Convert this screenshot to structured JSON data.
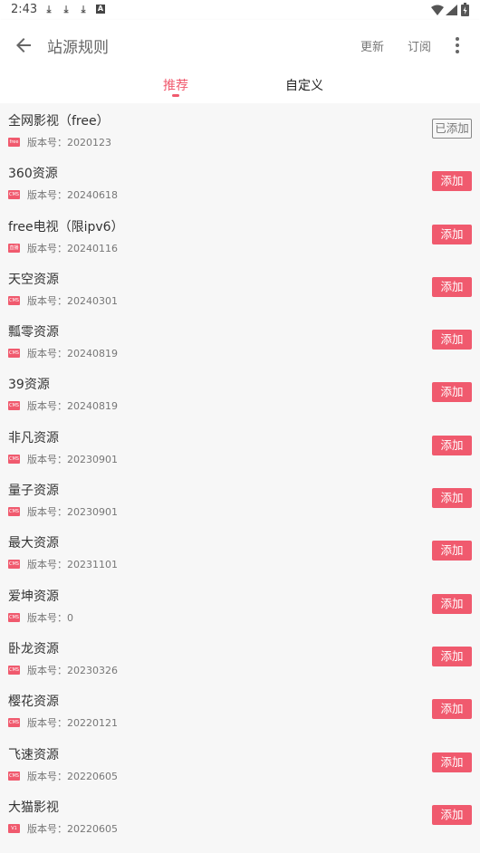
{
  "status_bar": {
    "time": "2:43",
    "a_icon": "A"
  },
  "toolbar": {
    "back_icon": "arrow-left-icon",
    "title": "站源规则",
    "update_label": "更新",
    "subscribe_label": "订阅",
    "more_icon": "more-vertical-icon"
  },
  "tabs": [
    {
      "label": "推荐",
      "active": true
    },
    {
      "label": "自定义",
      "active": false
    }
  ],
  "colors": {
    "accent": "#f05a6e",
    "added_border": "#888888",
    "background": "#f7f7f7"
  },
  "version_prefix": "版本号：",
  "sources": [
    {
      "name": "全网影视（free）",
      "badge": "free",
      "version": "2020123",
      "action": "已添加",
      "added": true
    },
    {
      "name": "360资源",
      "badge": "CMS",
      "version": "20240618",
      "action": "添加",
      "added": false
    },
    {
      "name": "free电视（限ipv6）",
      "badge": "直播",
      "version": "20240116",
      "action": "添加",
      "added": false
    },
    {
      "name": "天空资源",
      "badge": "CMS",
      "version": "20240301",
      "action": "添加",
      "added": false
    },
    {
      "name": "瓢零资源",
      "badge": "CMS",
      "version": "20240819",
      "action": "添加",
      "added": false
    },
    {
      "name": "39资源",
      "badge": "CMS",
      "version": "20240819",
      "action": "添加",
      "added": false
    },
    {
      "name": "非凡资源",
      "badge": "CMS",
      "version": "20230901",
      "action": "添加",
      "added": false
    },
    {
      "name": "量子资源",
      "badge": "CMS",
      "version": "20230901",
      "action": "添加",
      "added": false
    },
    {
      "name": "最大资源",
      "badge": "CMS",
      "version": "20231101",
      "action": "添加",
      "added": false
    },
    {
      "name": "爱坤资源",
      "badge": "CMS",
      "version": "0",
      "action": "添加",
      "added": false
    },
    {
      "name": "卧龙资源",
      "badge": "CMS",
      "version": "20230326",
      "action": "添加",
      "added": false
    },
    {
      "name": "樱花资源",
      "badge": "CMS",
      "version": "20220121",
      "action": "添加",
      "added": false
    },
    {
      "name": "飞速资源",
      "badge": "CMS",
      "version": "20220605",
      "action": "添加",
      "added": false
    },
    {
      "name": "大猫影视",
      "badge": "V1",
      "version": "20220605",
      "action": "添加",
      "added": false
    }
  ]
}
